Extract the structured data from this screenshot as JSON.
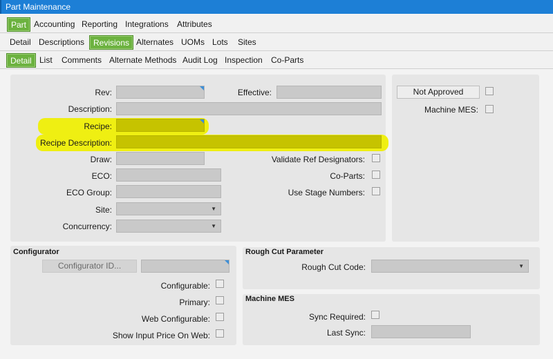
{
  "window": {
    "title": "Part Maintenance"
  },
  "tabs_main": [
    "Part",
    "Accounting",
    "Reporting",
    "Integrations",
    "Attributes"
  ],
  "tabs_sub": [
    "Detail",
    "Descriptions",
    "Revisions",
    "Alternates",
    "UOMs",
    "Lots",
    "Sites"
  ],
  "tabs_detail": [
    "Detail",
    "List",
    "Comments",
    "Alternate Methods",
    "Audit Log",
    "Inspection",
    "Co-Parts"
  ],
  "detail": {
    "rev": "Rev:",
    "effective": "Effective:",
    "description": "Description:",
    "recipe": "Recipe:",
    "recipe_description": "Recipe Description:",
    "draw": "Draw:",
    "eco": "ECO:",
    "eco_group": "ECO Group:",
    "site": "Site:",
    "concurrency": "Concurrency:",
    "validate_ref": "Validate Ref Designators:",
    "co_parts": "Co-Parts:",
    "use_stage": "Use Stage Numbers:"
  },
  "approval": {
    "not_approved_button": "Not Approved",
    "machine_mes": "Machine MES:"
  },
  "configurator": {
    "title": "Configurator",
    "id_button": "Configurator ID...",
    "configurable": "Configurable:",
    "primary": "Primary:",
    "web_configurable": "Web Configurable:",
    "show_input_price": "Show Input Price On Web:"
  },
  "rough_cut": {
    "title": "Rough Cut Parameter",
    "code": "Rough Cut Code:"
  },
  "machine_mes": {
    "title": "Machine MES",
    "sync_required": "Sync Required:",
    "last_sync": "Last Sync:"
  },
  "colors": {
    "title_bar": "#1d7fd6",
    "active_tab": "#6cb23f",
    "highlight": "#f0f000"
  }
}
